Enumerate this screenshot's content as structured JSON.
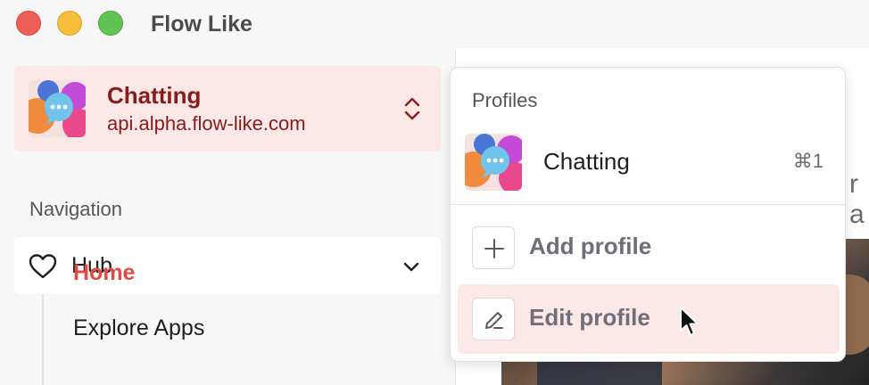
{
  "window": {
    "title": "Flow Like"
  },
  "sidebar": {
    "profile": {
      "name": "Chatting",
      "server": "api.alpha.flow-like.com"
    },
    "navigation": {
      "label": "Navigation",
      "group": {
        "label": "Hub",
        "items": [
          "Home",
          "Explore Apps"
        ],
        "active": "Home"
      }
    }
  },
  "main": {
    "peek_text": "r a"
  },
  "dropdown": {
    "heading": "Profiles",
    "profiles": [
      {
        "name": "Chatting",
        "shortcut": "⌘1"
      }
    ],
    "actions": [
      {
        "label": "Add profile"
      },
      {
        "label": "Edit profile"
      }
    ],
    "hovered": "Edit profile"
  },
  "colors": {
    "accent": "#e04b45",
    "accent_bg": "#fbe8e7",
    "profile_text": "#8a1b1b"
  }
}
